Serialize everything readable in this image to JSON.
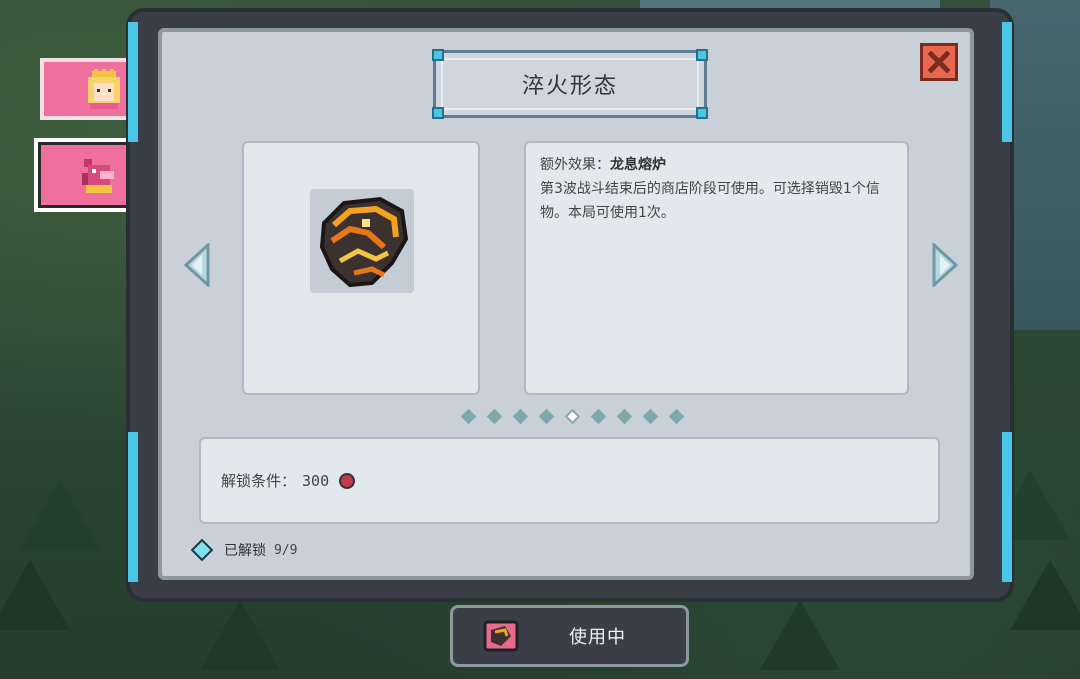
{
  "title": "淬火形态",
  "effect": {
    "label_prefix": "额外效果：",
    "name": "龙息熔炉",
    "description": "第3波战斗结束后的商店阶段可使用。可选择销毁1个信物。本局可使用1次。"
  },
  "unlock": {
    "label": "解锁条件：",
    "cost": "300"
  },
  "progress": {
    "label": "已解锁",
    "count": "9/9"
  },
  "pagination": {
    "total": 9,
    "current": 5
  },
  "use_button": {
    "label": "使用中"
  },
  "colors": {
    "tab_pink": "#ef6f9d",
    "accent_cyan": "#4bc6e6",
    "close_red": "#e8684f"
  },
  "icons": {
    "tab_a": "princess-icon",
    "tab_b": "dragon-icon",
    "close": "close-icon",
    "prev": "arrow-left-icon",
    "next": "arrow-right-icon",
    "currency": "gem-icon"
  }
}
